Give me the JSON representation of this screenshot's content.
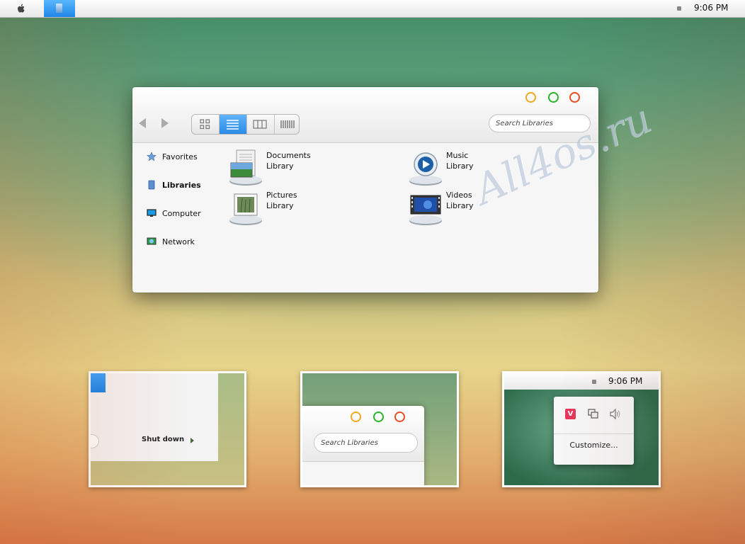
{
  "menubar": {
    "clock": "9:06 PM"
  },
  "window": {
    "search_placeholder": "Search Libraries",
    "sidebar": [
      {
        "label": "Favorites"
      },
      {
        "label": "Libraries"
      },
      {
        "label": "Computer"
      },
      {
        "label": "Network"
      }
    ],
    "libraries": [
      {
        "name": "Documents",
        "sub": "Library"
      },
      {
        "name": "Music",
        "sub": "Library"
      },
      {
        "name": "Pictures",
        "sub": "Library"
      },
      {
        "name": "Videos",
        "sub": "Library"
      }
    ],
    "buttons": {
      "minimize_color": "#f0a81e",
      "maximize_color": "#28b428",
      "close_color": "#e84c22"
    }
  },
  "thumbnails": {
    "shutdown_label": "Shut down",
    "search_placeholder": "Search Libraries",
    "clock": "9:06 PM",
    "customize_label": "Customize..."
  },
  "watermark": "All4os.ru",
  "colors": {
    "accent": "#2a8be6"
  }
}
